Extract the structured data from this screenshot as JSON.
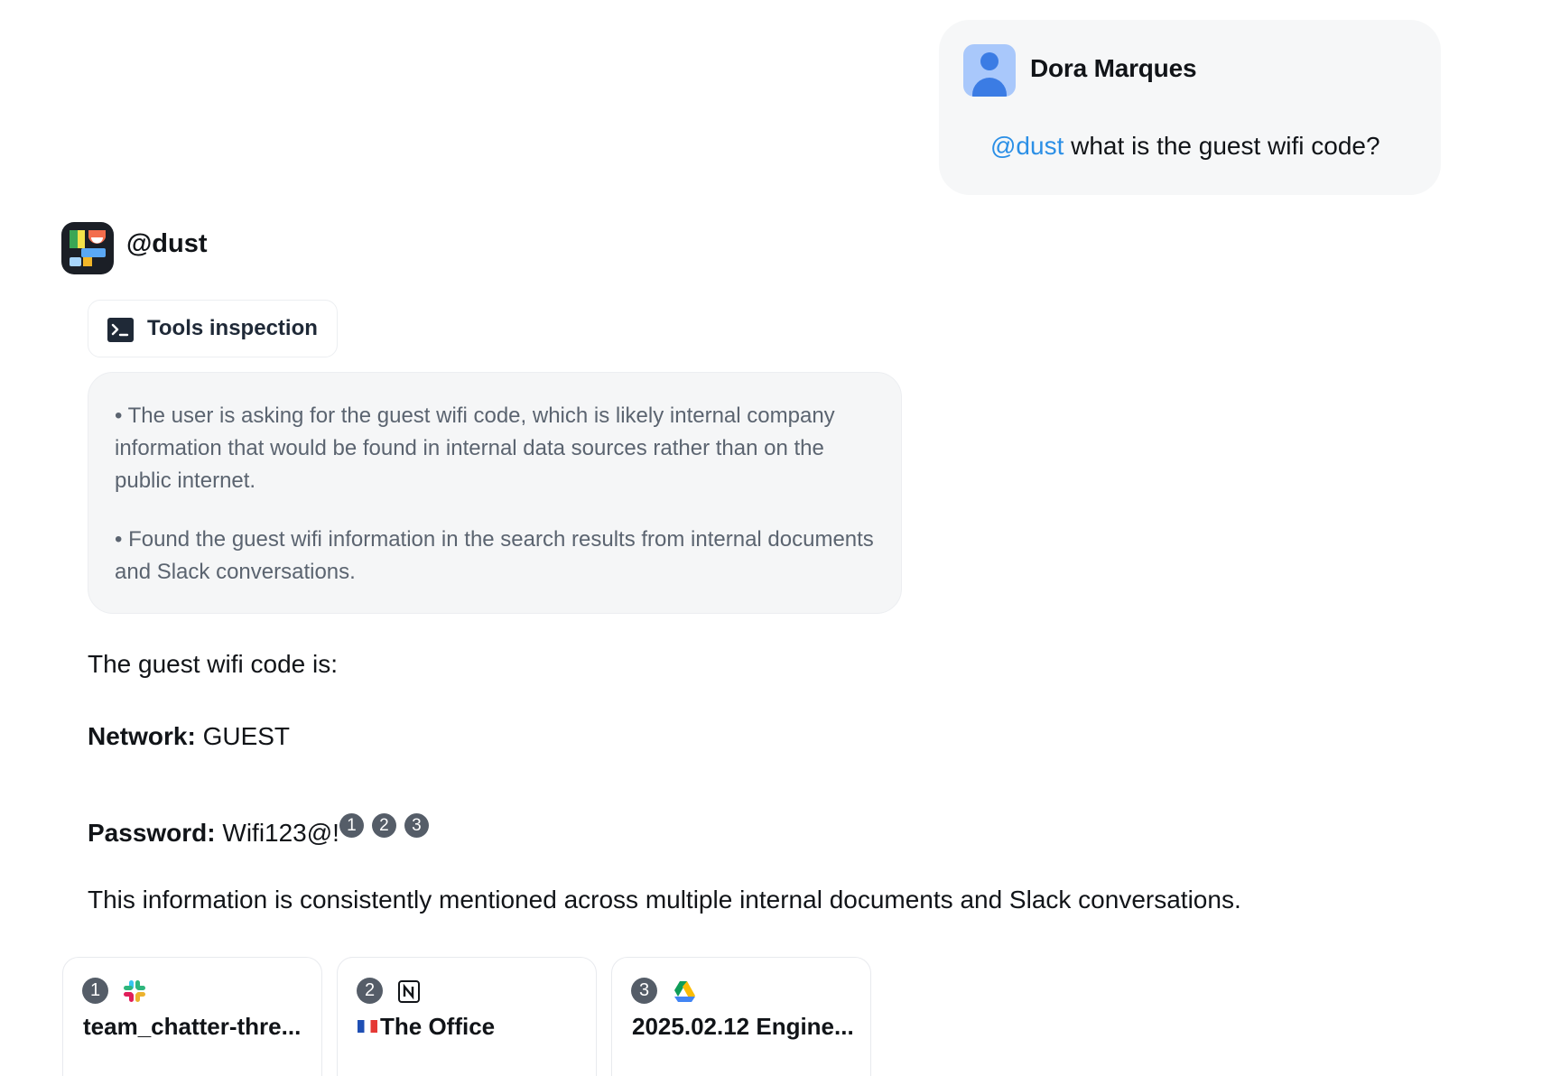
{
  "user_message": {
    "author": "Dora Marques",
    "mention": "@dust",
    "text": " what is the guest wifi code?"
  },
  "agent": {
    "name": "@dust",
    "tools_chip_label": "Tools inspection",
    "thoughts": [
      "• The user is asking for the guest wifi code, which is likely internal company information that would be found in internal data sources rather than on the public internet.",
      "• Found the guest wifi information in the search results from internal documents and Slack conversations."
    ],
    "answer": {
      "intro": "The guest wifi code is:",
      "network_label": "Network:",
      "network_value": " GUEST",
      "password_label": "Password:",
      "password_value": " Wifi123@!",
      "citations": [
        "1",
        "2",
        "3"
      ],
      "closing": "This information is consistently mentioned across multiple internal documents and Slack conversations."
    },
    "sources": [
      {
        "num": "1",
        "icon": "slack-icon",
        "title": "team_chatter-thre..."
      },
      {
        "num": "2",
        "icon": "notion-icon",
        "title": "The Office"
      },
      {
        "num": "3",
        "icon": "google-drive-icon",
        "title": "2025.02.12 Engine..."
      }
    ]
  },
  "colors": {
    "mention": "#2b8fe6",
    "citation_badge": "#555d68",
    "bubble_bg": "#f6f7f8",
    "thinking_bg": "#f5f6f7"
  }
}
